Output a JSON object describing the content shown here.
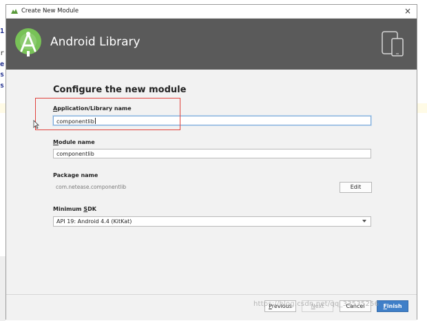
{
  "window": {
    "title": "Create New Module",
    "close_glyph": "×",
    "titlebar_icon": "android-studio-icon"
  },
  "banner": {
    "title": "Android Library",
    "logo_icon": "android-studio-logo-icon",
    "device_icon": "phone-tablet-icon",
    "bg_color": "#5a5a5a"
  },
  "form": {
    "heading": "Configure the new module",
    "app_name": {
      "label_mnemonic": "A",
      "label_rest": "pplication/Library name",
      "value": "componentlib"
    },
    "module_name": {
      "label_mnemonic": "M",
      "label_rest": "odule name",
      "value": "componentlib"
    },
    "package_name": {
      "label": "Package name",
      "value": "com.netease.componentlib",
      "edit_label": "Edit"
    },
    "min_sdk": {
      "label_rest1": "Minimum ",
      "label_mnemonic": "S",
      "label_rest2": "DK",
      "value": "API 19: Android 4.4 (KitKat)"
    }
  },
  "footer": {
    "previous_mnemonic": "P",
    "previous_rest": "revious",
    "next_mnemonic": "N",
    "next_rest": "ext",
    "cancel_label": "Cancel",
    "finish_mnemonic": "F",
    "finish_rest": "inish",
    "primary_color": "#3f7fc8"
  },
  "ide_background": {
    "chars": [
      "1",
      "r",
      "e",
      "s",
      "s"
    ]
  },
  "watermark": "https://blog.csdn.net/qq_33535256"
}
